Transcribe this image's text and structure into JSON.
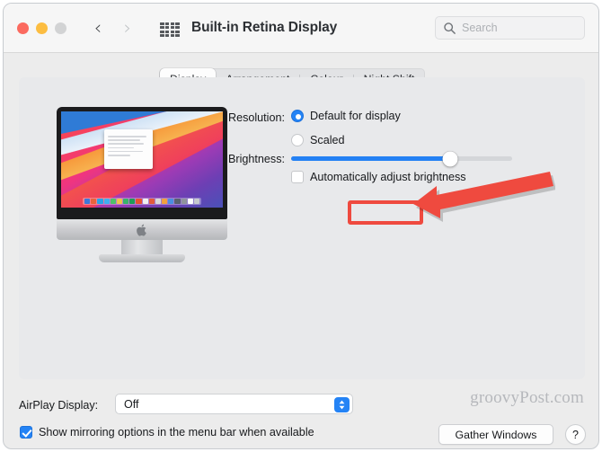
{
  "window": {
    "title": "Built-in Retina Display",
    "traffic_lights": [
      "close-button",
      "minimize-button",
      "zoom-button"
    ],
    "nav_back_glyph": "‹",
    "nav_forward_glyph": "›",
    "grid_icon_name": "show-all-grid-icon"
  },
  "search": {
    "placeholder": "Search",
    "value": "",
    "icon": "search-icon"
  },
  "tabs": [
    {
      "label": "Display",
      "selected": true
    },
    {
      "label": "Arrangement",
      "selected": false
    },
    {
      "label": "Colour",
      "selected": false
    },
    {
      "label": "Night Shift",
      "selected": false
    }
  ],
  "preview": {
    "device": "imac-display-preview",
    "apple_logo": "apple-logo-icon",
    "dock_icon_colors": [
      "#3f78d8",
      "#e8643c",
      "#2aa3e8",
      "#3fb0f0",
      "#4ec16a",
      "#f2c14a",
      "#38b46b",
      "#1f9d57",
      "#e8522f",
      "#f0f0f0",
      "#e35b3c",
      "#d9d9d9",
      "#f2a13c",
      "#4a8fe0",
      "#5a6270",
      "#8f949c",
      "#ffffff",
      "#c6c9ce"
    ]
  },
  "resolution": {
    "label": "Resolution:",
    "options": [
      {
        "label": "Default for display",
        "selected": true
      },
      {
        "label": "Scaled",
        "selected": false
      }
    ]
  },
  "brightness": {
    "label": "Brightness:",
    "value_percent": 72,
    "auto_adjust": {
      "label": "Automatically adjust brightness",
      "checked": false
    }
  },
  "annotation": {
    "highlight_target": "Scaled",
    "color": "#ef4a3f",
    "shapes": [
      "highlight-rectangle",
      "pointer-arrow"
    ]
  },
  "airplay": {
    "label": "AirPlay Display:",
    "value": "Off",
    "options": [
      "Off"
    ]
  },
  "mirroring": {
    "label": "Show mirroring options in the menu bar when available",
    "checked": true
  },
  "footer": {
    "gather_windows_label": "Gather Windows",
    "help_label": "?",
    "watermark": "groovyPost.com"
  },
  "colors": {
    "accent_blue": "#2483f5",
    "annotation_red": "#ef4a3f",
    "window_bg": "#ececec",
    "panel_bg": "#e8e9eb"
  }
}
